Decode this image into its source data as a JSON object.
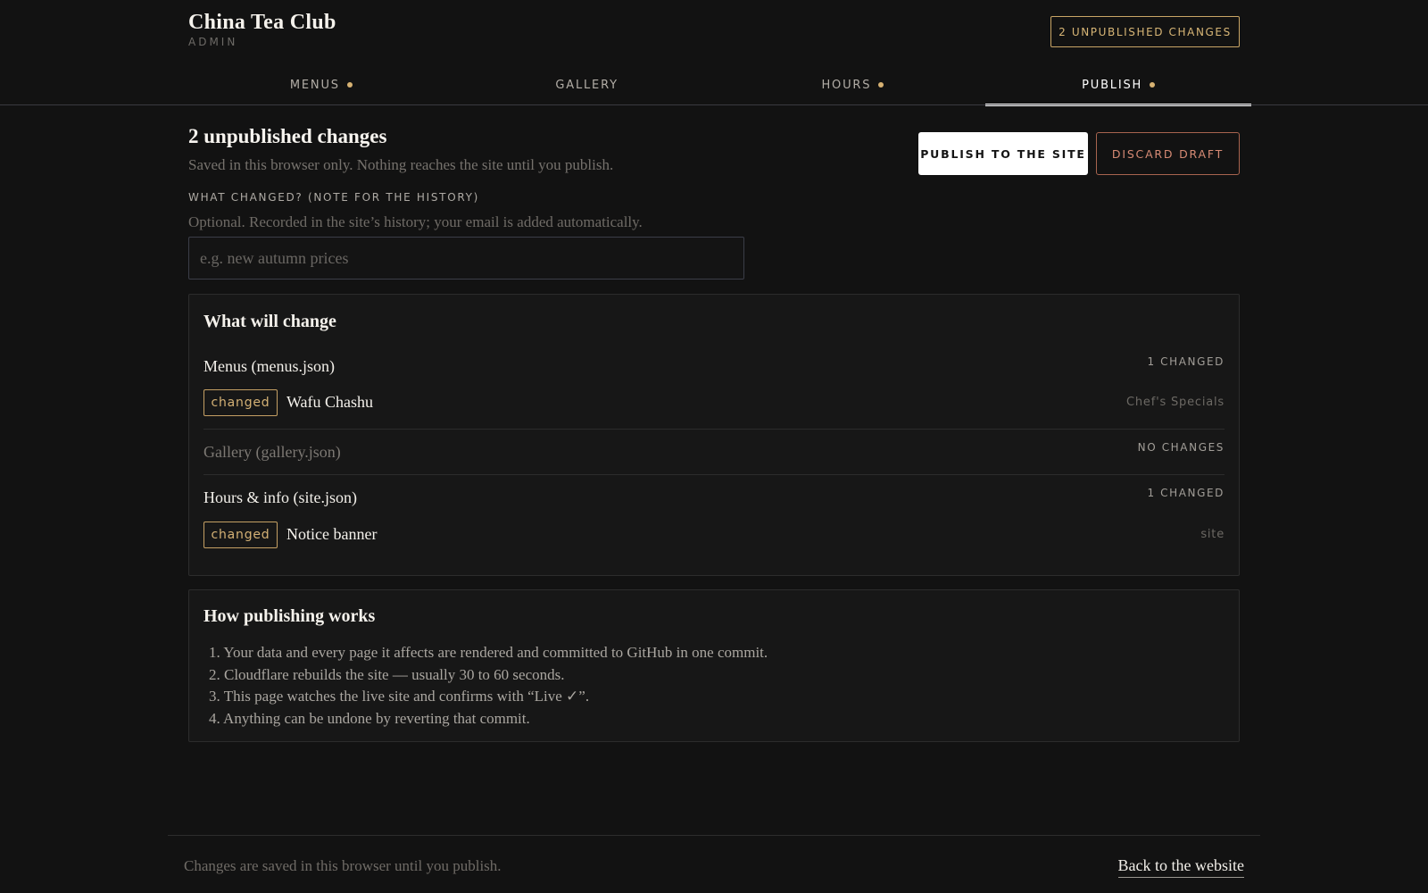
{
  "header": {
    "brand": "China Tea Club",
    "brand_sub": "ADMIN",
    "unpublished_badge": "2 UNPUBLISHED CHANGES"
  },
  "tabs": [
    {
      "label": "MENUS",
      "has_dot": true,
      "active": false
    },
    {
      "label": "GALLERY",
      "has_dot": false,
      "active": false
    },
    {
      "label": "HOURS",
      "has_dot": true,
      "active": false
    },
    {
      "label": "PUBLISH",
      "has_dot": true,
      "active": true
    }
  ],
  "publish": {
    "title": "2 unpublished changes",
    "subtitle": "Saved in this browser only. Nothing reaches the site until you publish.",
    "publish_button": "PUBLISH TO THE SITE",
    "discard_button": "DISCARD DRAFT",
    "note_label": "WHAT CHANGED? (NOTE FOR THE HISTORY)",
    "note_help": "Optional. Recorded in the site’s history; your email is added automatically.",
    "note_value": "",
    "note_placeholder": "e.g. new autumn prices"
  },
  "changes": {
    "title": "What will change",
    "groups": [
      {
        "title": "Menus (menus.json)",
        "count": "1 CHANGED",
        "items": [
          {
            "badge": "changed",
            "name": "Wafu Chashu",
            "scope": "Chef's Specials"
          }
        ]
      },
      {
        "title": "Gallery (gallery.json)",
        "count": "NO CHANGES",
        "items": []
      },
      {
        "title": "Hours & info (site.json)",
        "count": "1 CHANGED",
        "items": [
          {
            "badge": "changed",
            "name": "Notice banner",
            "scope": "site"
          }
        ]
      }
    ]
  },
  "howto": {
    "title": "How publishing works",
    "steps": [
      "1. Your data and every page it affects are rendered and committed to GitHub in one commit.",
      "2. Cloudflare rebuilds the site — usually 30 to 60 seconds.",
      "3. This page watches the live site and confirms with “Live ✓”.",
      "4. Anything can be undone by reverting that commit."
    ]
  },
  "footer": {
    "note": "Changes are saved in this browser until you publish.",
    "back_link": "Back to the website"
  },
  "colors": {
    "background": "#121212",
    "accent_gold": "#d4b175",
    "discard_red": "#d68a74"
  }
}
